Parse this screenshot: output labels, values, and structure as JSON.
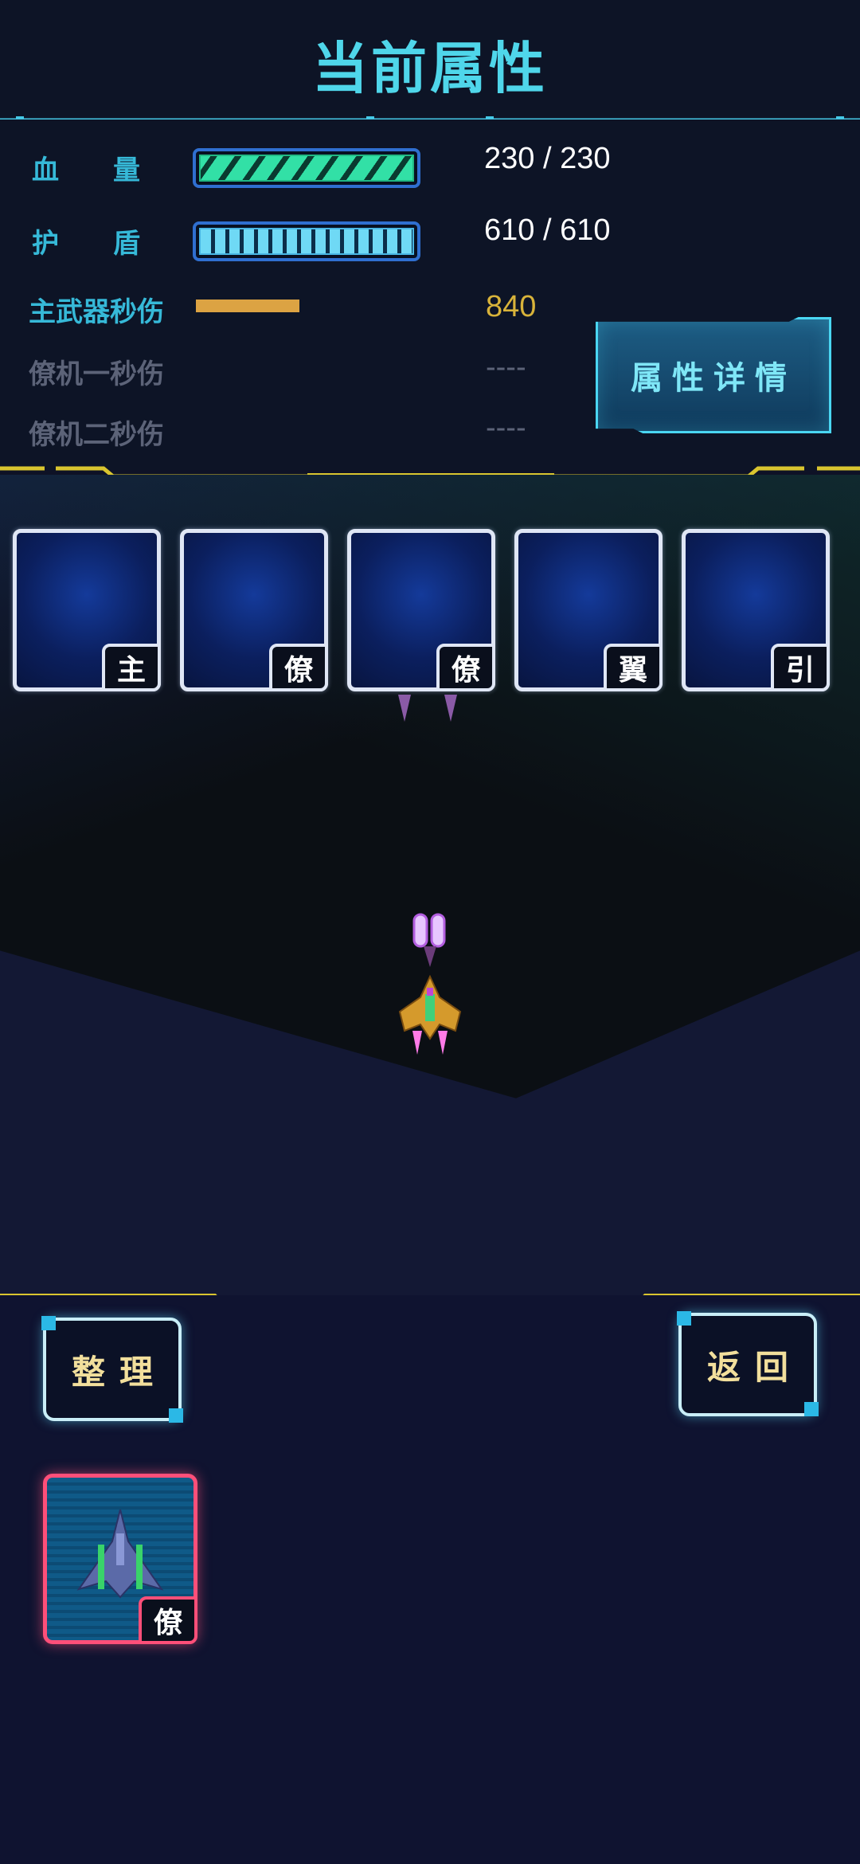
{
  "header": {
    "title": "当前属性"
  },
  "stats": {
    "hp": {
      "label": "血　　量",
      "value": "230 / 230",
      "fraction": 1.0
    },
    "shield": {
      "label": "护　　盾",
      "value": "610 / 610",
      "fraction": 1.0
    },
    "main_weapon_dps": {
      "label": "主武器秒伤",
      "value": "840"
    },
    "wingman1_dps": {
      "label": "僚机一秒伤",
      "value": "----"
    },
    "wingman2_dps": {
      "label": "僚机二秒伤",
      "value": "----"
    },
    "detail_button": "属性详情"
  },
  "slots": [
    {
      "tag": "主"
    },
    {
      "tag": "僚"
    },
    {
      "tag": "僚"
    },
    {
      "tag": "翼"
    },
    {
      "tag": "引"
    }
  ],
  "buttons": {
    "sort": "整理",
    "back": "返回"
  },
  "inventory": [
    {
      "tag": "僚"
    }
  ],
  "colors": {
    "accent_cyan": "#4fd6ea",
    "hp_green": "#32e0a6",
    "shield_blue": "#6fd9f5",
    "weapon_orange": "#dca343",
    "divider_yellow": "#d9c52f",
    "selected_pink": "#ff4f79"
  }
}
